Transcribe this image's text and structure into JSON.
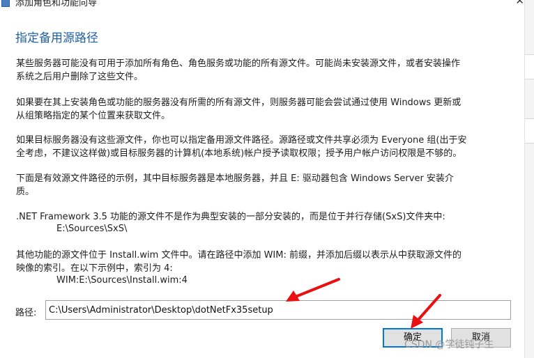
{
  "window": {
    "title": "添加角色和功能向导"
  },
  "heading": "指定备用源路径",
  "paragraphs": {
    "p1_line1": "某些服务器可能没有可用于添加所有角色、角色服务或功能的所有源文件。可能尚未安装源文件，或者安装操作",
    "p1_line2": "系统之后用户删除了这些文件。",
    "p2_line1": "如果要在其上安装角色或功能的服务器没有所需的所有源文件，则服务器可能会尝试通过使用 Windows 更新或",
    "p2_line2": "从组策略指定的某个位置来获取文件。",
    "p3_line1": "如果目标服务器没有这些源文件，你也可以指定备用源文件路径。源路径或文件共享必须为 Everyone 组(出于安",
    "p3_line2": "全考虑，不建议这样做)或目标服务器的计算机(本地系统)帐户授予读取权限；授予用户帐户访问权限是不够的。",
    "p4_line1": "下面是有效源文件路径的示例，其中目标服务器是本地服务器，并且 E: 驱动器包含 Windows Server 安装介",
    "p4_line2": "质。",
    "p5_line1": ".NET Framework 3.5 功能的源文件不是作为典型安装的一部分安装的，而是位于并行存储(SxS)文件夹中:",
    "p5_example": "E:\\Sources\\SxS\\",
    "p6_line1": "其他功能的源文件位于 Install.wim 文件中。请在路径中添加 WIM: 前缀，并添加后缀以表示从中获取源文件的",
    "p6_line2": "映像的索引。在以下示例中，索引为 4:",
    "p6_example": "WIM:E:\\Sources\\Install.wim:4"
  },
  "path": {
    "label": "路径:",
    "value": "C:\\Users\\Administrator\\Desktop\\dotNetFx35setup"
  },
  "buttons": {
    "ok": "确定",
    "cancel": "取消"
  },
  "watermark": "CSDN @学徒钝子生",
  "colors": {
    "heading": "#1f5fa8",
    "arrow": "#e81010",
    "ok_border": "#0078d7"
  }
}
